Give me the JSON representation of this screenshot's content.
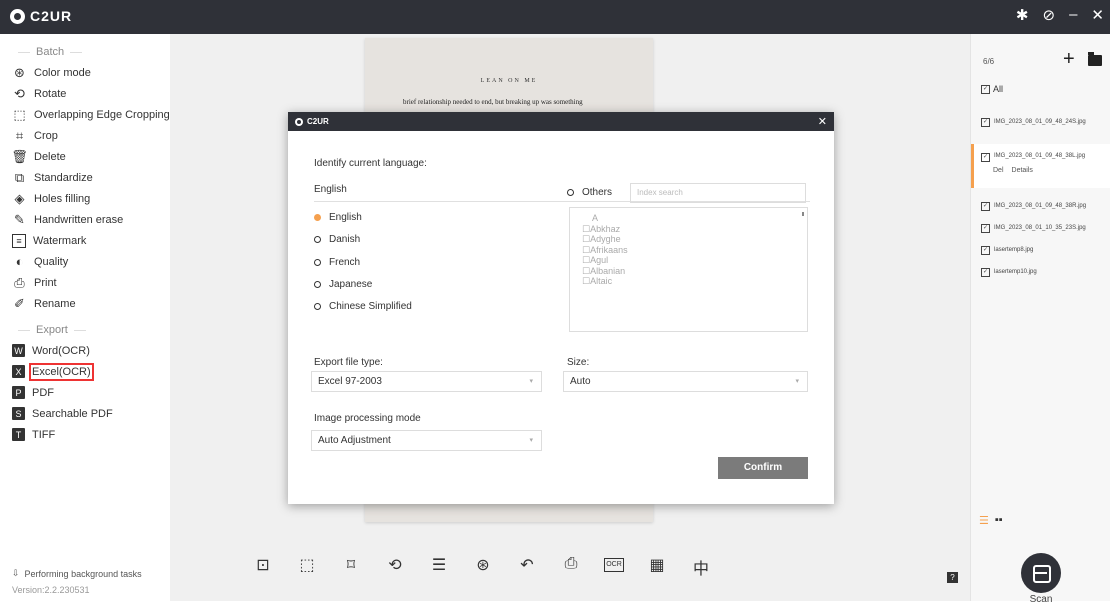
{
  "app": {
    "title": "C2UR"
  },
  "sidebar": {
    "batch_label": "Batch",
    "batch_items": [
      {
        "label": "Color mode",
        "icon": "color-mode-icon"
      },
      {
        "label": "Rotate",
        "icon": "rotate-icon"
      },
      {
        "label": "Overlapping Edge Cropping",
        "icon": "overlap-crop-icon"
      },
      {
        "label": "Crop",
        "icon": "crop-icon"
      },
      {
        "label": "Delete",
        "icon": "trash-icon"
      },
      {
        "label": "Standardize",
        "icon": "standardize-icon"
      },
      {
        "label": "Holes filling",
        "icon": "fill-icon"
      },
      {
        "label": "Handwritten erase",
        "icon": "erase-icon"
      },
      {
        "label": "Watermark",
        "icon": "watermark-icon"
      },
      {
        "label": "Quality",
        "icon": "quality-icon"
      },
      {
        "label": "Print",
        "icon": "print-icon"
      },
      {
        "label": "Rename",
        "icon": "rename-icon"
      }
    ],
    "export_label": "Export",
    "export_items": [
      {
        "label": "Word(OCR)",
        "icon": "word-icon"
      },
      {
        "label": "Excel(OCR)",
        "icon": "excel-icon"
      },
      {
        "label": "PDF",
        "icon": "pdf-icon"
      },
      {
        "label": "Searchable PDF",
        "icon": "searchable-pdf-icon"
      },
      {
        "label": "TIFF",
        "icon": "tiff-icon"
      }
    ],
    "status_text": "Performing background tasks",
    "version": "Version:2.2.230531"
  },
  "document": {
    "title": "LEAN ON ME",
    "line": "brief relationship needed to end, but breaking up was something"
  },
  "dialog": {
    "title": "C2UR",
    "identify_label": "Identify current language:",
    "current_language": "English",
    "languages": [
      "English",
      "Danish",
      "French",
      "Japanese",
      "Chinese Simplified"
    ],
    "selected_language": "English",
    "others_label": "Others",
    "search_placeholder": "Index search",
    "other_letter": "A",
    "other_languages": [
      "Abkhaz",
      "Adyghe",
      "Afrikaans",
      "Agul",
      "Albanian",
      "Altaic"
    ],
    "export_type_label": "Export file type:",
    "export_type_value": "Excel 97-2003",
    "size_label": "Size:",
    "size_value": "Auto",
    "processing_label": "Image processing mode",
    "processing_value": "Auto Adjustment",
    "confirm_label": "Confirm"
  },
  "right_panel": {
    "count": "6/6",
    "all_label": "All",
    "files": [
      "IMG_2023_08_01_09_48_24S.jpg",
      "IMG_2023_08_01_09_48_38L.jpg",
      "IMG_2023_08_01_09_48_38R.jpg",
      "IMG_2023_08_01_10_35_23S.jpg",
      "lasertemp8.jpg",
      "lasertemp10.jpg"
    ],
    "del_label": "Del",
    "details_label": "Details",
    "scan_label": "Scan"
  },
  "colors": {
    "titlebar": "#2f3138",
    "accent": "#f5a04e",
    "highlight_border": "#e33333",
    "confirm_bg": "#7b7b7b"
  }
}
